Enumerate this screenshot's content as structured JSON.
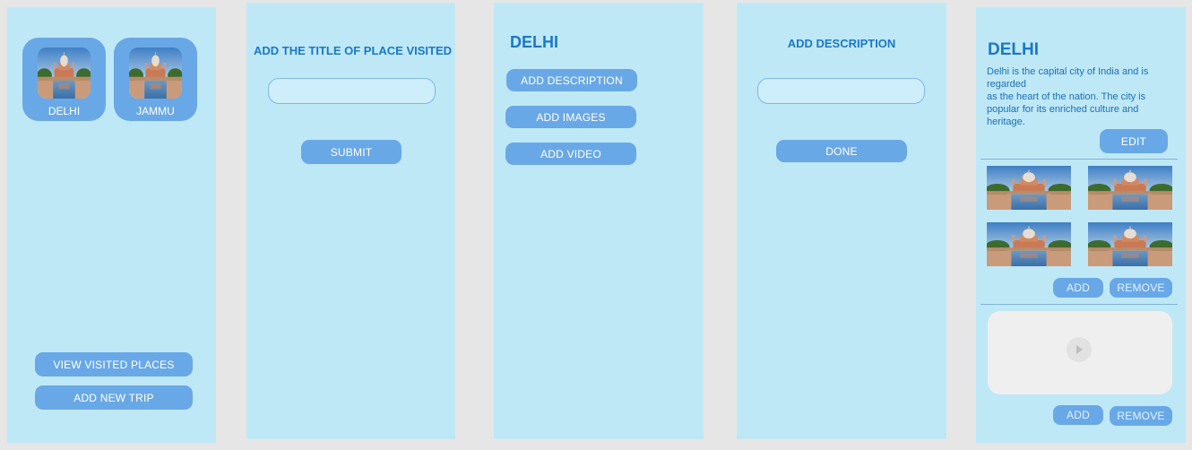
{
  "screen1": {
    "places": [
      {
        "label": "DELHI",
        "icon": "monument-image"
      },
      {
        "label": "JAMMU",
        "icon": "monument-image"
      }
    ],
    "view_visited_label": "VIEW VISITED PLACES",
    "add_trip_label": "ADD NEW TRIP"
  },
  "screen2": {
    "heading": "ADD THE TITLE OF PLACE VISITED",
    "title_input_value": "",
    "submit_label": "SUBMIT"
  },
  "screen3": {
    "heading": "DELHI",
    "add_description_label": "ADD DESCRIPTION",
    "add_images_label": "ADD IMAGES",
    "add_video_label": "ADD VIDEO"
  },
  "screen4": {
    "heading": "ADD DESCRIPTION",
    "description_input_value": "",
    "done_label": "DONE"
  },
  "screen5": {
    "heading": "DELHI",
    "description": "Delhi is the capital city of India and is regarded\nas the heart of the nation. The city is popular for its enriched culture and heritage.",
    "edit_label": "EDIT",
    "images_add_label": "ADD",
    "images_remove_label": "REMOVE",
    "video_add_label": "ADD",
    "video_remove_label": "REMOVE"
  },
  "colors": {
    "screen_bg": "#bfe8f7",
    "button": "#69a8e6",
    "heading": "#1a78c7",
    "page_bg": "#e6e6e6"
  }
}
